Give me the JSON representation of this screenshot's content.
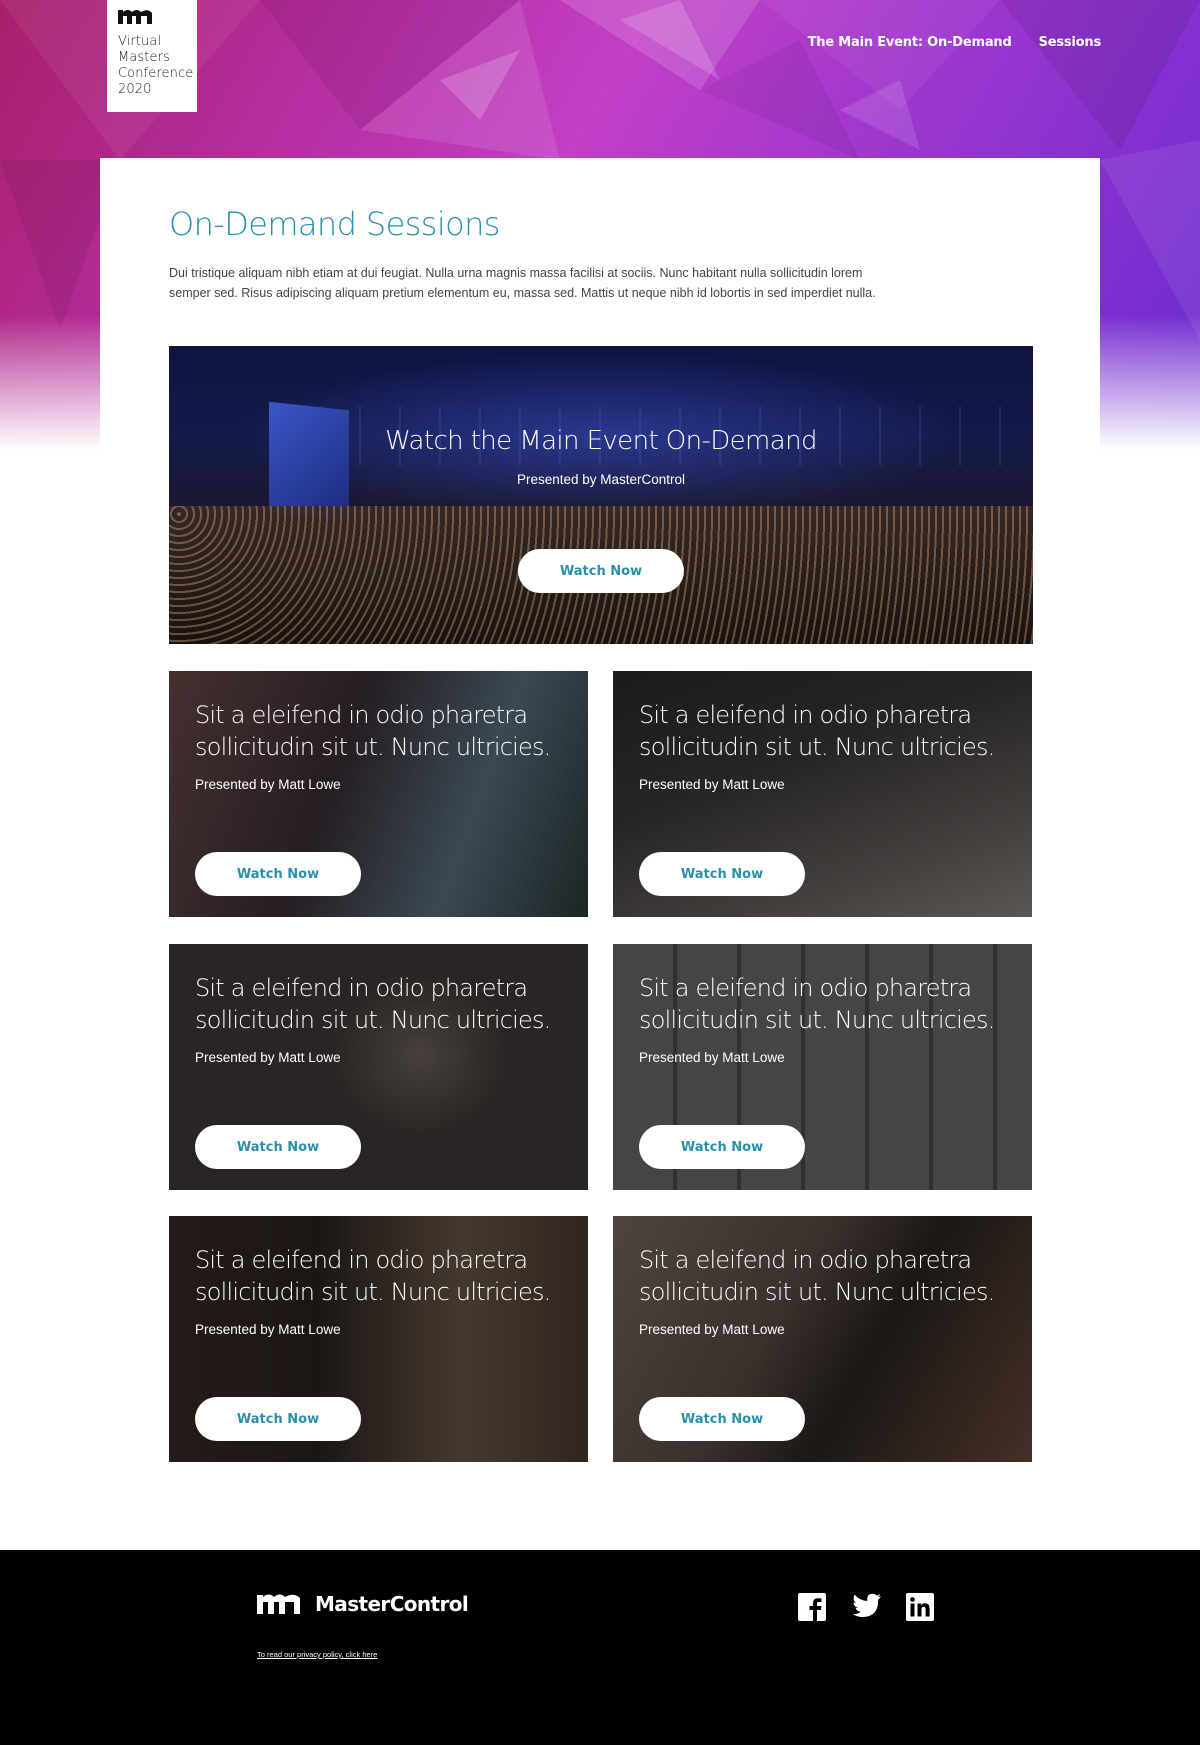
{
  "header": {
    "logo_text": "Virtual\nMasters\nConference\n2020",
    "nav": [
      {
        "label": "The Main Event: On-Demand"
      },
      {
        "label": "Sessions"
      }
    ]
  },
  "main": {
    "title": "On-Demand Sessions",
    "intro": "Dui tristique aliquam nibh etiam at dui feugiat. Nulla urna magnis massa facilisi at sociis. Nunc habitant nulla sollicitudin lorem semper sed. Risus adipiscing aliquam pretium elementum eu, massa sed. Mattis ut neque nibh id lobortis in sed imperdiet nulla.",
    "feature": {
      "title": "Watch the Main Event On-Demand",
      "presenter": "Presented by MasterControl",
      "button": "Watch Now"
    },
    "sessions": [
      {
        "title": "Sit a eleifend in odio pharetra sollicitudin sit ut. Nunc ultricies.",
        "presenter": "Presented by Matt Lowe",
        "button": "Watch Now"
      },
      {
        "title": "Sit a eleifend in odio pharetra sollicitudin sit ut. Nunc ultricies.",
        "presenter": "Presented by Matt Lowe",
        "button": "Watch Now"
      },
      {
        "title": "Sit a eleifend in odio pharetra sollicitudin sit ut. Nunc ultricies.",
        "presenter": "Presented by Matt Lowe",
        "button": "Watch Now"
      },
      {
        "title": "Sit a eleifend in odio pharetra sollicitudin sit ut. Nunc ultricies.",
        "presenter": "Presented by Matt Lowe",
        "button": "Watch Now"
      },
      {
        "title": "Sit a eleifend in odio pharetra sollicitudin sit ut. Nunc ultricies.",
        "presenter": "Presented by Matt Lowe",
        "button": "Watch Now"
      },
      {
        "title": "Sit a eleifend in odio pharetra sollicitudin sit ut. Nunc ultricies.",
        "presenter": "Presented by Matt Lowe",
        "button": "Watch Now"
      }
    ]
  },
  "footer": {
    "brand": "MasterControl",
    "privacy": "To read our privacy policy, click here",
    "social": [
      "facebook-icon",
      "twitter-icon",
      "linkedin-icon"
    ]
  },
  "colors": {
    "accent": "#2a8fa8",
    "footer_bg": "#000000"
  }
}
